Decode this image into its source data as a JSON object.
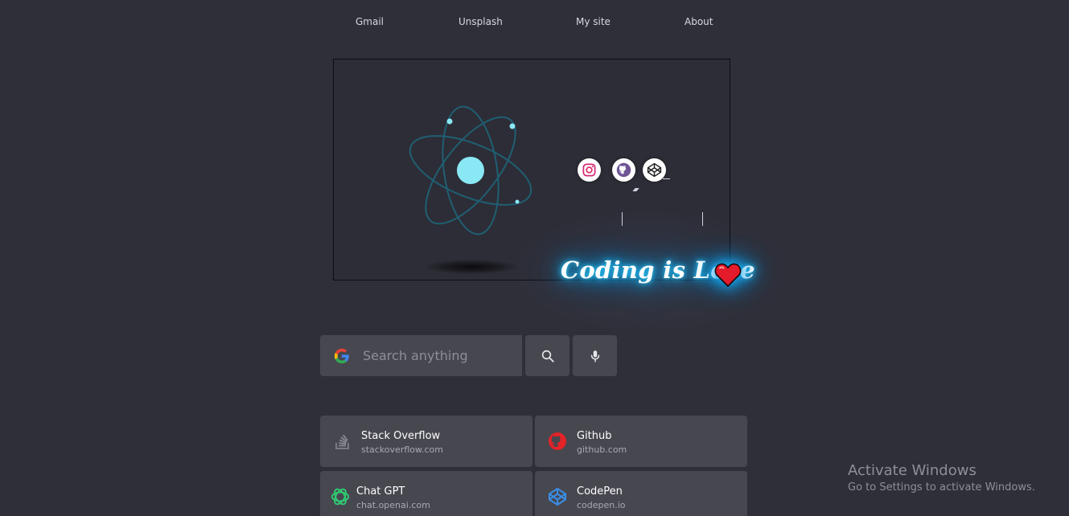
{
  "nav": {
    "items": [
      {
        "label": "Gmail"
      },
      {
        "label": "Unsplash"
      },
      {
        "label": "My site"
      },
      {
        "label": "About"
      }
    ]
  },
  "hero": {
    "tagline": "Coding is Love",
    "social_icons": [
      "instagram-icon",
      "github-icon",
      "codepen-icon"
    ],
    "accent_color": "#8ae8f5",
    "glow_color": "#15b8ff"
  },
  "search": {
    "placeholder": "Search anything",
    "engine_icon": "google-icon",
    "search_button_icon": "search-icon",
    "voice_button_icon": "microphone-icon"
  },
  "shortcuts": [
    {
      "title": "Stack Overflow",
      "url": "stackoverflow.com",
      "icon": "stackoverflow-icon"
    },
    {
      "title": "Github",
      "url": "github.com",
      "icon": "github-icon"
    },
    {
      "title": "Chat GPT",
      "url": "chat.openai.com",
      "icon": "chatgpt-icon"
    },
    {
      "title": "CodePen",
      "url": "codepen.io",
      "icon": "codepen-icon"
    }
  ],
  "watermark": {
    "title": "Activate Windows",
    "subtitle": "Go to Settings to activate Windows."
  }
}
